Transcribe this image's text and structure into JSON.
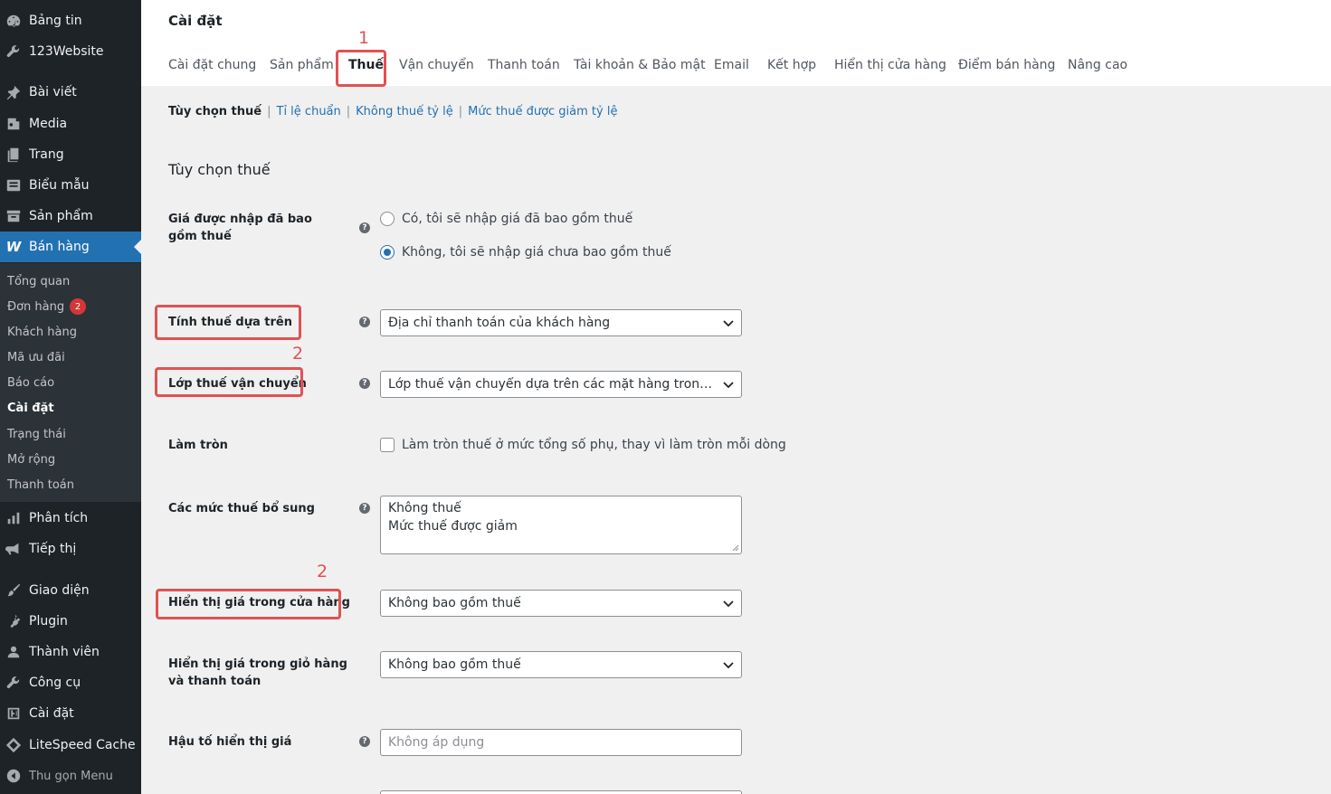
{
  "sidebar": {
    "top_items": [
      {
        "label": "Bảng tin",
        "icon": "dashboard-icon"
      },
      {
        "label": "123Website",
        "icon": "wrench-icon"
      }
    ],
    "items": [
      {
        "label": "Bài viết",
        "icon": "pin-icon"
      },
      {
        "label": "Media",
        "icon": "media-icon"
      },
      {
        "label": "Trang",
        "icon": "page-icon"
      },
      {
        "label": "Biểu mẫu",
        "icon": "form-icon"
      },
      {
        "label": "Sản phẩm",
        "icon": "archive-icon"
      },
      {
        "label": "Bán hàng",
        "icon": "woocommerce-icon"
      }
    ],
    "submenu": [
      {
        "label": "Tổng quan"
      },
      {
        "label": "Đơn hàng",
        "badge": "2"
      },
      {
        "label": "Khách hàng"
      },
      {
        "label": "Mã ưu đãi"
      },
      {
        "label": "Báo cáo"
      },
      {
        "label": "Cài đặt"
      },
      {
        "label": "Trạng thái"
      },
      {
        "label": "Mở rộng"
      },
      {
        "label": "Thanh toán"
      }
    ],
    "bottom_items": [
      {
        "label": "Phân tích",
        "icon": "chart-icon"
      },
      {
        "label": "Tiếp thị",
        "icon": "megaphone-icon"
      },
      {
        "label": "Giao diện",
        "icon": "paintbrush-icon"
      },
      {
        "label": "Plugin",
        "icon": "plugin-icon"
      },
      {
        "label": "Thành viên",
        "icon": "user-icon"
      },
      {
        "label": "Công cụ",
        "icon": "tools-icon"
      },
      {
        "label": "Cài đặt",
        "icon": "settings-icon"
      },
      {
        "label": "LiteSpeed Cache",
        "icon": "litespeed-icon"
      },
      {
        "label": "Thu gọn Menu",
        "icon": "collapse-icon"
      }
    ]
  },
  "header": {
    "title": "Cài đặt",
    "tabs": [
      {
        "label": "Cài đặt chung"
      },
      {
        "label": "Sản phẩm"
      },
      {
        "label": "Thuế"
      },
      {
        "label": "Vận chuyển"
      },
      {
        "label": "Thanh toán"
      },
      {
        "label": "Tài khoản & Bảo mật"
      },
      {
        "label": "Email"
      },
      {
        "label": "Kết hợp"
      },
      {
        "label": "Hiển thị cửa hàng"
      },
      {
        "label": "Điểm bán hàng"
      },
      {
        "label": "Nâng cao"
      }
    ]
  },
  "subnav": {
    "current": "Tùy chọn thuế",
    "links": [
      "Tỉ lệ chuẩn",
      "Không thuế tỷ lệ",
      "Mức thuế được giảm tỷ lệ"
    ],
    "separator": "|"
  },
  "section_title": "Tùy chọn thuế",
  "fields": {
    "prices_entered": {
      "label": "Giá được nhập đã bao gồm thuế",
      "options": [
        "Có, tôi sẽ nhập giá đã bao gồm thuế",
        "Không, tôi sẽ nhập giá chưa bao gồm thuế"
      ],
      "selected": 1
    },
    "tax_based_on": {
      "label": "Tính thuế dựa trên",
      "value": "Địa chỉ thanh toán của khách hàng"
    },
    "shipping_tax_class": {
      "label": "Lớp thuế vận chuyển",
      "value": "Lớp thuế vận chuyển dựa trên các mặt hàng trong giỏ hàng"
    },
    "rounding": {
      "label": "Làm tròn",
      "checkbox_label": "Làm tròn thuế ở mức tổng số phụ, thay vì làm tròn mỗi dòng",
      "checked": false
    },
    "additional_tax_classes": {
      "label": "Các mức thuế bổ sung",
      "lines": [
        "Không thuế",
        "Mức thuế được giảm"
      ]
    },
    "display_prices_shop": {
      "label": "Hiển thị giá trong cửa hàng",
      "value": "Không bao gồm thuế"
    },
    "display_prices_cart": {
      "label": "Hiển thị giá trong giỏ hàng và thanh toán",
      "value": "Không bao gồm thuế"
    },
    "price_display_suffix": {
      "label": "Hậu tố hiển thị giá",
      "placeholder": "Không áp dụng"
    }
  },
  "help_glyph": "?",
  "annotations": {
    "step1": "1",
    "step2a": "2",
    "step2b": "2",
    "color": "#e05252"
  },
  "colors": {
    "accent": "#2271b1",
    "sidebar_bg": "#1d2327",
    "submenu_bg": "#2c3338"
  }
}
